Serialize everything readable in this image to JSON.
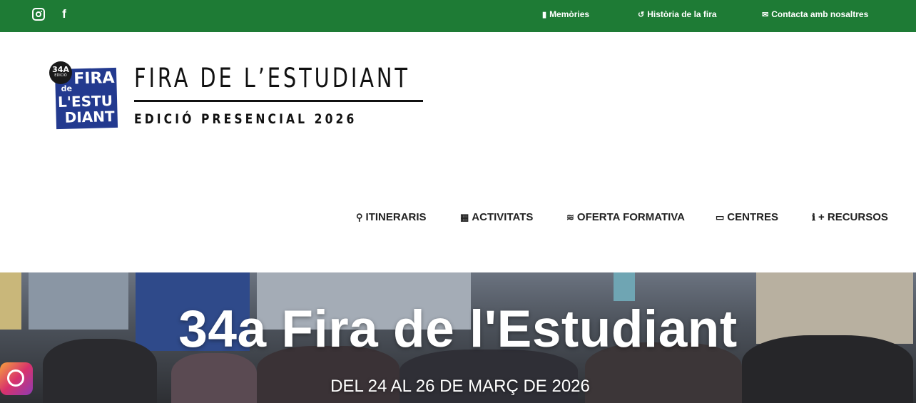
{
  "topbar": {
    "color": "#1e7b35",
    "social": [
      {
        "icon": "instagram-icon"
      },
      {
        "icon": "facebook-icon",
        "glyph": "f"
      }
    ],
    "links": [
      {
        "label": "Memòries",
        "icon": "book-icon"
      },
      {
        "label": "Història de la fira",
        "icon": "history-icon"
      },
      {
        "label": "Contacta amb nosaltres",
        "icon": "envelope-icon"
      }
    ]
  },
  "logo": {
    "badge_number": "34A",
    "badge_caption": "EDICIÓ",
    "badge_words": [
      "FIRA",
      "de",
      "L'ESTU",
      "DIANT"
    ],
    "title": "FIRA DE L’ESTUDIANT",
    "subtitle": "EDICIÓ PRESENCIAL 2026",
    "badge_color": "#233a8f"
  },
  "nav": {
    "items": [
      {
        "label": "ITINERARIS",
        "icon": "route-icon",
        "glyph": "⚲"
      },
      {
        "label": "ACTIVITATS",
        "icon": "calendar-check-icon",
        "glyph": "▦"
      },
      {
        "label": "OFERTA FORMATIVA",
        "icon": "layers-icon",
        "glyph": "≋"
      },
      {
        "label": "CENTRES",
        "icon": "chalkboard-teacher-icon",
        "glyph": "▭"
      },
      {
        "label": "+ RECURSOS",
        "icon": "info-circle-icon",
        "glyph": "ℹ"
      }
    ]
  },
  "hero": {
    "title": "34a Fira de l'Estudiant",
    "subtitle": "DEL 24 AL 26 DE MARÇ DE 2026"
  }
}
